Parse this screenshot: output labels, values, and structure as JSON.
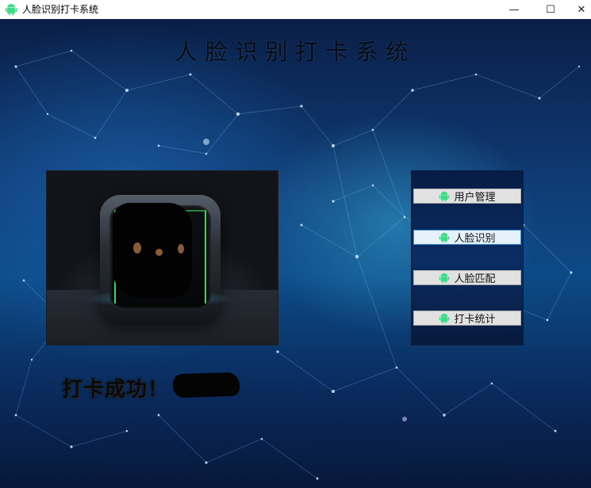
{
  "window": {
    "title": "人脸识别打卡系统",
    "icon": "android-icon",
    "controls": {
      "minimize": "—",
      "maximize": "☐",
      "close": "✕"
    }
  },
  "header": {
    "title": "人脸识别打卡系统"
  },
  "camera": {
    "image": "camera-preview-app-tile",
    "face_box_color": "#3fd45a"
  },
  "menu": {
    "items": [
      {
        "label": "用户管理",
        "icon": "android-icon"
      },
      {
        "label": "人脸识别",
        "icon": "android-icon",
        "active": true
      },
      {
        "label": "人脸匹配",
        "icon": "android-icon"
      },
      {
        "label": "打卡统计",
        "icon": "android-icon"
      }
    ]
  },
  "status": {
    "message": "打卡成功！"
  },
  "colors": {
    "android_green": "#3ddc84",
    "active_border": "#3c8fd8",
    "button_bg": "#e1e1e1"
  }
}
